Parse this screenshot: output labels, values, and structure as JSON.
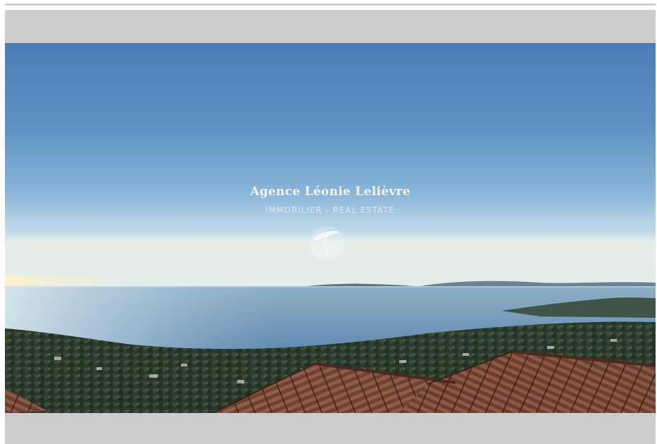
{
  "brand": {
    "name": "Agence  Léonie Lelièvre",
    "tagline": "IMMOBILIER - REAL ESTATE",
    "logo_icon": "umbrella-pine-tree-icon"
  },
  "photo": {
    "subject": "sea-view-landscape"
  },
  "colors": {
    "band_gray": "#cdcdcd",
    "sky_top": "#4a7fb8",
    "sky_horizon": "#b9d3e6",
    "sea": "#6f9cc1",
    "roof": "#7a4a3a"
  }
}
